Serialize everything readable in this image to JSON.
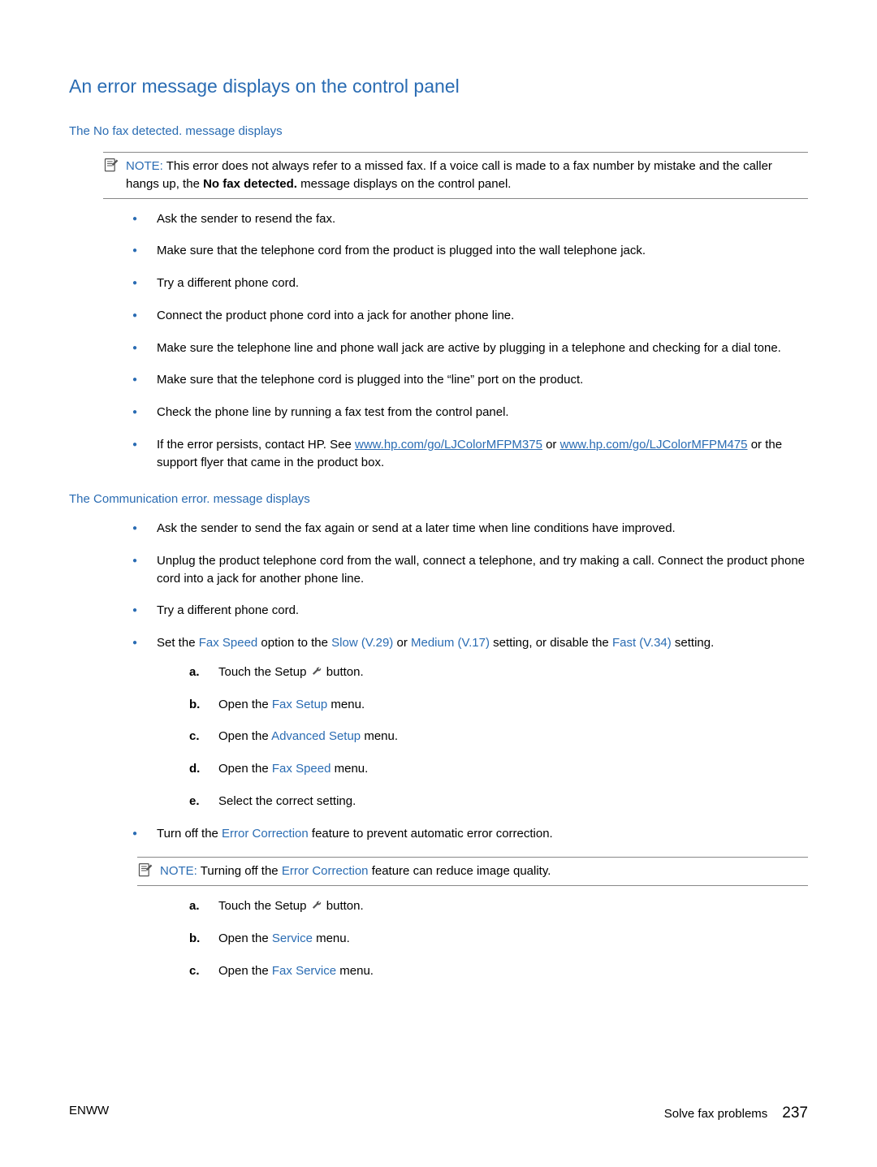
{
  "title": "An error message displays on the control panel",
  "section1": {
    "heading": "The No fax detected. message displays",
    "note": {
      "label": "NOTE:",
      "text1": "This error does not always refer to a missed fax. If a voice call is made to a fax number by mistake and the caller hangs up, the ",
      "bold": "No fax detected.",
      "text2": " message displays on the control panel."
    },
    "bullets": {
      "b1": "Ask the sender to resend the fax.",
      "b2": "Make sure that the telephone cord from the product is plugged into the wall telephone jack.",
      "b3": "Try a different phone cord.",
      "b4": "Connect the product phone cord into a jack for another phone line.",
      "b5": "Make sure the telephone line and phone wall jack are active by plugging in a telephone and checking for a dial tone.",
      "b6": "Make sure that the telephone cord is plugged into the “line” port on the product.",
      "b7": "Check the phone line by running a fax test from the control panel.",
      "b8a": "If the error persists, contact HP. See ",
      "b8link1": "www.hp.com/go/LJColorMFPM375",
      "b8b": " or ",
      "b8link2": "www.hp.com/go/LJColorMFPM475",
      "b8c": " or the support flyer that came in the product box."
    }
  },
  "section2": {
    "heading": "The Communication error. message displays",
    "bullets": {
      "b1": "Ask the sender to send the fax again or send at a later time when line conditions have improved.",
      "b2": "Unplug the product telephone cord from the wall, connect a telephone, and try making a call. Connect the product phone cord into a jack for another phone line.",
      "b3": "Try a different phone cord.",
      "b4a": "Set the ",
      "b4s1": "Fax Speed",
      "b4b": " option to the ",
      "b4s2": "Slow (V.29)",
      "b4c": " or ",
      "b4s3": "Medium (V.17)",
      "b4d": " setting, or disable the ",
      "b4s4": "Fast (V.34)",
      "b4e": " setting.",
      "b5a": "Turn off the ",
      "b5s1": "Error Correction",
      "b5b": " feature to prevent automatic error correction."
    },
    "note2": {
      "label": "NOTE:",
      "t1": "Turning off the ",
      "s1": "Error Correction",
      "t2": " feature can reduce image quality."
    },
    "steps1": {
      "a1": "Touch the Setup ",
      "a2": " button.",
      "b1": "Open the ",
      "bs": "Fax Setup",
      "b2": " menu.",
      "c1": "Open the ",
      "cs": "Advanced Setup",
      "c2": " menu.",
      "d1": "Open the ",
      "ds": "Fax Speed",
      "d2": " menu.",
      "e": "Select the correct setting."
    },
    "steps2": {
      "a1": "Touch the Setup ",
      "a2": " button.",
      "b1": "Open the ",
      "bs": "Service",
      "b2": " menu.",
      "c1": "Open the ",
      "cs": "Fax Service",
      "c2": " menu."
    },
    "labels": {
      "a": "a.",
      "b": "b.",
      "c": "c.",
      "d": "d.",
      "e": "e."
    }
  },
  "footer": {
    "left": "ENWW",
    "rightText": "Solve fax problems",
    "page": "237"
  }
}
